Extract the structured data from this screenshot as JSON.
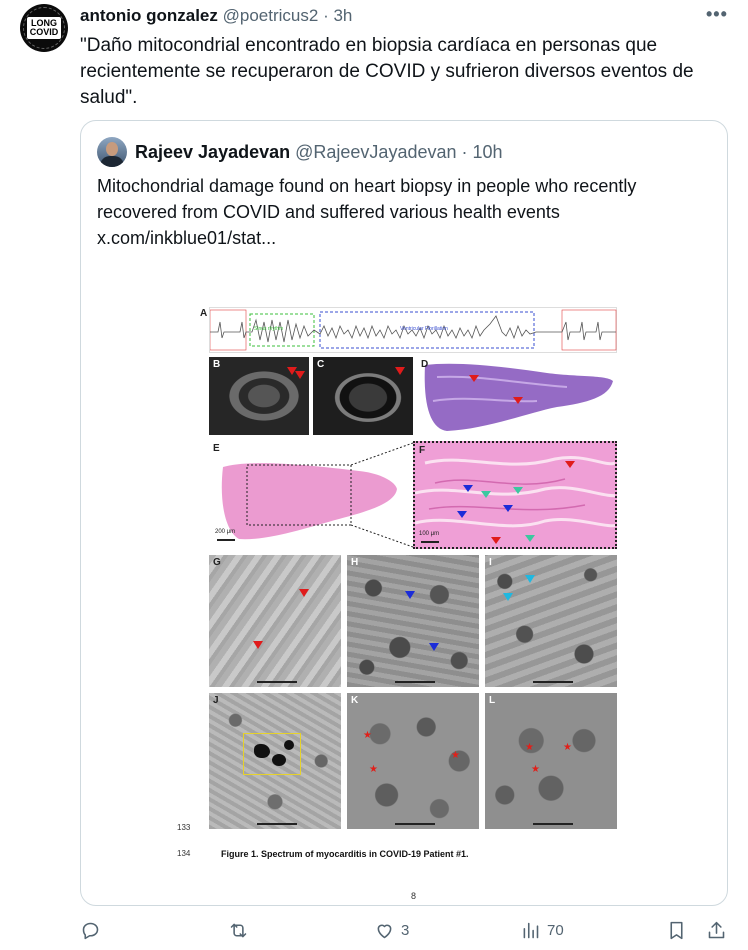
{
  "tweet": {
    "author_name": "antonio gonzalez",
    "author_handle": "@poetricus2",
    "separator": "·",
    "time": "3h",
    "avatar_text": [
      "LONG",
      "COVID"
    ],
    "text": "\"Daño mitocondrial encontrado en biopsia cardíaca en personas que recientemente se recuperaron de COVID y sufrieron diversos eventos de salud\".",
    "more_label": "•••"
  },
  "quote": {
    "author_name": "Rajeev Jayadevan",
    "author_handle": "@RajeevJayadevan",
    "separator": "·",
    "time": "10h",
    "text": "Mitochondrial damage found on heart biopsy in people who recently recovered from COVID and suffered various health events  x.com/inkblue01/stat..."
  },
  "figure": {
    "panel_labels": [
      "A",
      "B",
      "C",
      "D",
      "E",
      "F",
      "G",
      "H",
      "I",
      "J",
      "K",
      "L"
    ],
    "ecg_left_label": "Sinus rhythm",
    "ecg_middle_label": "Ventricular Fibrillation",
    "scale_e": "200 μm",
    "scale_f": "100 μm",
    "line_133": "133",
    "line_134": "134",
    "caption": "Figure 1. Spectrum of myocarditis in COVID-19 Patient #1.",
    "page_number": "8"
  },
  "actions": {
    "reply_count": "",
    "retweet_count": "",
    "like_count": "3",
    "views_count": "70"
  },
  "colors": {
    "text_primary": "#0f1419",
    "text_secondary": "#536471",
    "border": "#cfd9de",
    "he_pink": "#e78ac8",
    "he_purple": "#8a5bbf"
  }
}
